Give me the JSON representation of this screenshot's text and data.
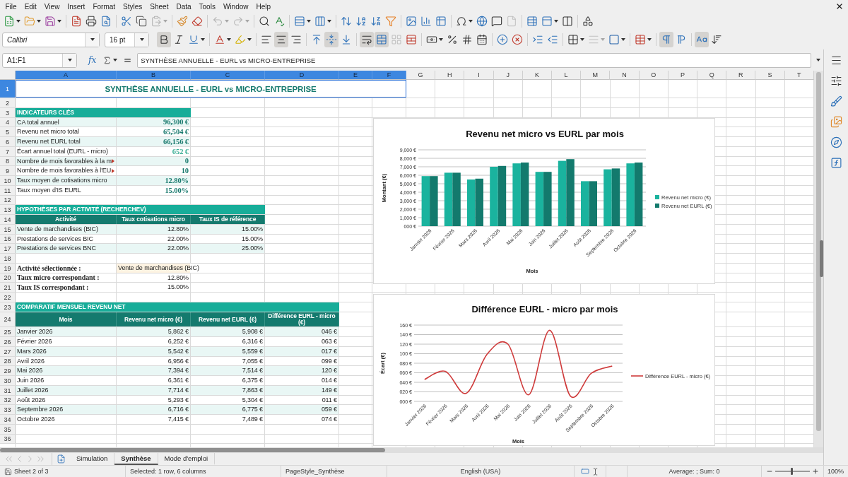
{
  "menu_bar": [
    "File",
    "Edit",
    "View",
    "Insert",
    "Format",
    "Styles",
    "Sheet",
    "Data",
    "Tools",
    "Window",
    "Help"
  ],
  "toolbar_standard": [
    [
      {
        "kind": "new",
        "active": false,
        "disabled": false,
        "menu": true
      },
      {
        "kind": "open",
        "active": false,
        "disabled": false,
        "menu": true
      },
      {
        "kind": "save",
        "active": false,
        "disabled": false,
        "menu": true
      }
    ],
    [
      {
        "kind": "export_pdf",
        "active": false,
        "disabled": false,
        "menu": false
      },
      {
        "kind": "print",
        "active": false,
        "disabled": false,
        "menu": false
      },
      {
        "kind": "print_preview",
        "active": false,
        "disabled": false,
        "menu": false
      }
    ],
    [
      {
        "kind": "cut",
        "active": false,
        "disabled": false,
        "menu": false
      },
      {
        "kind": "copy",
        "active": false,
        "disabled": false,
        "menu": false
      },
      {
        "kind": "paste",
        "active": false,
        "disabled": true,
        "menu": true
      }
    ],
    [
      {
        "kind": "clone_format",
        "active": false,
        "disabled": false,
        "menu": false
      },
      {
        "kind": "clear_format",
        "active": false,
        "disabled": false,
        "menu": false
      }
    ],
    [
      {
        "kind": "undo",
        "active": false,
        "disabled": true,
        "menu": true
      },
      {
        "kind": "redo",
        "active": false,
        "disabled": true,
        "menu": true
      }
    ],
    [
      {
        "kind": "find_replace",
        "active": false,
        "disabled": false,
        "menu": false
      },
      {
        "kind": "spelling",
        "active": false,
        "disabled": false,
        "menu": false
      }
    ],
    [
      {
        "kind": "rows",
        "active": false,
        "disabled": false,
        "menu": true
      },
      {
        "kind": "columns",
        "active": false,
        "disabled": false,
        "menu": true
      }
    ],
    [
      {
        "kind": "sort",
        "active": false,
        "disabled": false,
        "menu": false
      },
      {
        "kind": "sort_ascending",
        "active": false,
        "disabled": false,
        "menu": false
      },
      {
        "kind": "sort_descending",
        "active": false,
        "disabled": false,
        "menu": false
      },
      {
        "kind": "autofilter",
        "active": false,
        "disabled": false,
        "menu": false
      }
    ],
    [
      {
        "kind": "image",
        "active": false,
        "disabled": false,
        "menu": false
      },
      {
        "kind": "chart",
        "active": false,
        "disabled": false,
        "menu": false
      },
      {
        "kind": "pivot_table",
        "active": false,
        "disabled": false,
        "menu": false
      }
    ],
    [
      {
        "kind": "special_character",
        "active": false,
        "disabled": false,
        "menu": true
      },
      {
        "kind": "hyperlink",
        "active": false,
        "disabled": false,
        "menu": false
      },
      {
        "kind": "comment",
        "active": false,
        "disabled": false,
        "menu": false
      },
      {
        "kind": "header_footer",
        "active": false,
        "disabled": true,
        "menu": false
      }
    ],
    [
      {
        "kind": "print_area",
        "active": false,
        "disabled": false,
        "menu": false
      },
      {
        "kind": "freeze",
        "active": false,
        "disabled": false,
        "menu": true
      },
      {
        "kind": "split_window",
        "active": false,
        "disabled": false,
        "menu": false
      }
    ],
    [
      {
        "kind": "shapes",
        "active": false,
        "disabled": false,
        "menu": false
      }
    ]
  ],
  "toolbar_format": {
    "font_name": "Calibri",
    "font_size": "16 pt",
    "groups": [
      [
        {
          "kind": "bold",
          "active": true,
          "disabled": false,
          "menu": false
        },
        {
          "kind": "italic",
          "active": false,
          "disabled": false,
          "menu": false
        },
        {
          "kind": "underline",
          "active": false,
          "disabled": false,
          "menu": true
        }
      ],
      [
        {
          "kind": "font_color",
          "active": false,
          "disabled": false,
          "menu": true
        },
        {
          "kind": "highlight",
          "active": false,
          "disabled": false,
          "menu": true
        }
      ],
      [
        {
          "kind": "align_left",
          "active": false,
          "disabled": false,
          "menu": false
        },
        {
          "kind": "align_center",
          "active": true,
          "disabled": false,
          "menu": false
        },
        {
          "kind": "align_right",
          "active": false,
          "disabled": false,
          "menu": false
        }
      ],
      [
        {
          "kind": "align_top",
          "active": false,
          "disabled": false,
          "menu": false
        },
        {
          "kind": "align_middle",
          "active": true,
          "disabled": false,
          "menu": false
        },
        {
          "kind": "align_bottom",
          "active": false,
          "disabled": false,
          "menu": false
        }
      ],
      [
        {
          "kind": "wrap_text",
          "active": true,
          "disabled": false,
          "menu": false
        },
        {
          "kind": "merge_center",
          "active": true,
          "disabled": false,
          "menu": false
        },
        {
          "kind": "merge",
          "active": false,
          "disabled": true,
          "menu": false
        },
        {
          "kind": "unmerge",
          "active": false,
          "disabled": false,
          "menu": false
        }
      ],
      [
        {
          "kind": "currency",
          "active": false,
          "disabled": false,
          "menu": true
        },
        {
          "kind": "percent",
          "active": false,
          "disabled": false,
          "menu": false
        },
        {
          "kind": "number",
          "active": false,
          "disabled": false,
          "menu": false
        },
        {
          "kind": "date",
          "active": false,
          "disabled": false,
          "menu": false
        }
      ],
      [
        {
          "kind": "add_decimal",
          "active": false,
          "disabled": false,
          "menu": false
        },
        {
          "kind": "delete_decimal",
          "active": false,
          "disabled": false,
          "menu": false
        }
      ],
      [
        {
          "kind": "indent",
          "active": false,
          "disabled": false,
          "menu": false
        },
        {
          "kind": "outdent",
          "active": false,
          "disabled": false,
          "menu": false
        }
      ],
      [
        {
          "kind": "borders",
          "active": false,
          "disabled": false,
          "menu": true
        },
        {
          "kind": "border_style",
          "active": false,
          "disabled": true,
          "menu": true
        },
        {
          "kind": "border_color",
          "active": false,
          "disabled": false,
          "menu": true
        }
      ],
      [
        {
          "kind": "conditional",
          "active": false,
          "disabled": false,
          "menu": true
        }
      ],
      [
        {
          "kind": "ltr",
          "active": true,
          "disabled": false,
          "menu": false
        },
        {
          "kind": "rtl",
          "active": false,
          "disabled": false,
          "menu": false
        }
      ],
      [
        {
          "kind": "text_horizontal",
          "active": true,
          "disabled": false,
          "menu": false
        },
        {
          "kind": "text_vertical",
          "active": false,
          "disabled": false,
          "menu": false
        }
      ]
    ]
  },
  "formula_bar": {
    "name_box": "A1:F1",
    "function_wizard": "fx",
    "content": "SYNTHÈSE ANNUELLE - EURL vs MICRO-ENTREPRISE"
  },
  "sidebar": [
    {
      "kind": "menu"
    },
    {
      "kind": "properties"
    },
    {
      "kind": "styles"
    },
    {
      "kind": "gallery"
    },
    {
      "kind": "navigator"
    },
    {
      "kind": "functions"
    }
  ],
  "sheet": {
    "columns": [
      {
        "label": "A",
        "selected": true
      },
      {
        "label": "B",
        "selected": true
      },
      {
        "label": "C",
        "selected": true
      },
      {
        "label": "D",
        "selected": true
      },
      {
        "label": "E",
        "selected": true
      },
      {
        "label": "F",
        "selected": true
      },
      {
        "label": "G",
        "selected": false
      },
      {
        "label": "H",
        "selected": false
      },
      {
        "label": "I",
        "selected": false
      },
      {
        "label": "J",
        "selected": false
      },
      {
        "label": "K",
        "selected": false
      },
      {
        "label": "L",
        "selected": false
      },
      {
        "label": "M",
        "selected": false
      },
      {
        "label": "N",
        "selected": false
      },
      {
        "label": "O",
        "selected": false
      },
      {
        "label": "P",
        "selected": false
      },
      {
        "label": "Q",
        "selected": false
      },
      {
        "label": "R",
        "selected": false
      },
      {
        "label": "S",
        "selected": false
      },
      {
        "label": "T",
        "selected": false
      }
    ],
    "rows": [
      {
        "number": "1",
        "selected": true,
        "kind": "title",
        "text": "SYNTHÈSE ANNUELLE - EURL vs MICRO-ENTREPRISE"
      },
      {
        "number": "2",
        "selected": false,
        "kind": "blank"
      },
      {
        "number": "3",
        "selected": false,
        "kind": "section",
        "text": "INDICATEURS CLÉS"
      },
      {
        "number": "4",
        "selected": false,
        "kind": "indicator",
        "label": "CA total annuel",
        "value": "96,300 €",
        "color": "#1a7a6e",
        "clipped": false
      },
      {
        "number": "5",
        "selected": false,
        "kind": "indicator",
        "label": "Revenu net micro total",
        "value": "65,504 €",
        "color": "#1a7a6e",
        "clipped": false
      },
      {
        "number": "6",
        "selected": false,
        "kind": "indicator",
        "label": "Revenu net EURL total",
        "value": "66,156 €",
        "color": "#1a7a6e",
        "clipped": false
      },
      {
        "number": "7",
        "selected": false,
        "kind": "indicator",
        "label": "Écart annuel total (EURL - micro)",
        "value": "652 €",
        "color": "#3daf96",
        "clipped": false
      },
      {
        "number": "8",
        "selected": false,
        "kind": "indicator",
        "label": "Nombre de mois favorables à la m",
        "value": "0",
        "color": "#1a7a6e",
        "clipped": true
      },
      {
        "number": "9",
        "selected": false,
        "kind": "indicator",
        "label": "Nombre de mois favorables à l'EU",
        "value": "10",
        "color": "#1a7a6e",
        "clipped": true
      },
      {
        "number": "10",
        "selected": false,
        "kind": "indicator",
        "label": "Taux moyen de cotisations micro",
        "value": "12.80%",
        "color": "#1a7a6e",
        "clipped": false
      },
      {
        "number": "11",
        "selected": false,
        "kind": "indicator",
        "label": "Taux moyen d'IS EURL",
        "value": "15.00%",
        "color": "#1a7a6e",
        "clipped": false
      },
      {
        "number": "12",
        "selected": false,
        "kind": "blank"
      },
      {
        "number": "13",
        "selected": false,
        "kind": "section",
        "text": "HYPOTHÈSES PAR ACTIVITÉ (RECHERCHEV)"
      },
      {
        "number": "14",
        "selected": false,
        "kind": "header",
        "cells": [
          "Activité",
          "Taux cotisations micro",
          "Taux IS de référence"
        ]
      },
      {
        "number": "15",
        "selected": false,
        "kind": "data",
        "cells": [
          "Vente de marchandises (BIC)",
          "12.80%",
          "15.00%"
        ]
      },
      {
        "number": "16",
        "selected": false,
        "kind": "data",
        "cells": [
          "Prestations de services BIC",
          "22.00%",
          "15.00%"
        ]
      },
      {
        "number": "17",
        "selected": false,
        "kind": "data",
        "cells": [
          "Prestations de services BNC",
          "22.00%",
          "25.00%"
        ]
      },
      {
        "number": "18",
        "selected": false,
        "kind": "blank"
      },
      {
        "number": "19",
        "selected": false,
        "kind": "select_field",
        "label": "Activité sélectionnée :",
        "value": "Vente de marchandises (BIC)"
      },
      {
        "number": "20",
        "selected": false,
        "kind": "field",
        "label": "Taux micro correspondant :",
        "value": "12.80%"
      },
      {
        "number": "21",
        "selected": false,
        "kind": "field",
        "label": "Taux IS correspondant :",
        "value": "15.00%"
      },
      {
        "number": "22",
        "selected": false,
        "kind": "blank"
      },
      {
        "number": "23",
        "selected": false,
        "kind": "section",
        "text": "COMPARATIF MENSUEL REVENU NET"
      },
      {
        "number": "24",
        "selected": false,
        "kind": "header",
        "cells": [
          "Mois",
          "Revenu net micro (€)",
          "Revenu net EURL (€)",
          "Différence EURL - micro (€)"
        ]
      },
      {
        "number": "25",
        "selected": false,
        "kind": "data",
        "cells": [
          "Janvier 2026",
          "5,862 €",
          "5,908 €",
          "046 €"
        ]
      },
      {
        "number": "26",
        "selected": false,
        "kind": "data",
        "cells": [
          "Février 2026",
          "6,252 €",
          "6,316 €",
          "063 €"
        ]
      },
      {
        "number": "27",
        "selected": false,
        "kind": "data",
        "cells": [
          "Mars 2026",
          "5,542 €",
          "5,559 €",
          "017 €"
        ]
      },
      {
        "number": "28",
        "selected": false,
        "kind": "data",
        "cells": [
          "Avril 2026",
          "6,956 €",
          "7,055 €",
          "099 €"
        ]
      },
      {
        "number": "29",
        "selected": false,
        "kind": "data",
        "cells": [
          "Mai 2026",
          "7,394 €",
          "7,514 €",
          "120 €"
        ]
      },
      {
        "number": "30",
        "selected": false,
        "kind": "data",
        "cells": [
          "Juin 2026",
          "6,361 €",
          "6,375 €",
          "014 €"
        ]
      },
      {
        "number": "31",
        "selected": false,
        "kind": "data",
        "cells": [
          "Juillet 2026",
          "7,714 €",
          "7,863 €",
          "149 €"
        ]
      },
      {
        "number": "32",
        "selected": false,
        "kind": "data",
        "cells": [
          "Août 2026",
          "5,293 €",
          "5,304 €",
          "011 €"
        ]
      },
      {
        "number": "33",
        "selected": false,
        "kind": "data",
        "cells": [
          "Septembre 2026",
          "6,716 €",
          "6,775 €",
          "059 €"
        ]
      },
      {
        "number": "34",
        "selected": false,
        "kind": "data",
        "cells": [
          "Octobre 2026",
          "7,415 €",
          "7,489 €",
          "074 €"
        ]
      },
      {
        "number": "35",
        "selected": false,
        "kind": "blank"
      },
      {
        "number": "36",
        "selected": false,
        "kind": "blank"
      }
    ]
  },
  "charts": [
    {
      "chart_data": {
        "type": "bar",
        "title": "Revenu net micro vs EURL par mois",
        "xlabel": "Mois",
        "ylabel": "Montant (€)",
        "categories": [
          "Janvier 2026",
          "Février 2026",
          "Mars 2026",
          "Avril 2026",
          "Mai 2026",
          "Juin 2026",
          "Juillet 2026",
          "Août 2026",
          "Septembre 2026",
          "Octobre 2026"
        ],
        "series": [
          {
            "name": "Revenu net micro (€)",
            "color": "#1ab39e",
            "values": [
              5900,
              6300,
              5500,
              7000,
              7400,
              6400,
              7700,
              5300,
              6700,
              7400
            ]
          },
          {
            "name": "Revenu net EURL (€)",
            "color": "#137a6d",
            "values": [
              5900,
              6300,
              5600,
              7100,
              7500,
              6400,
              7900,
              5300,
              6800,
              7500
            ]
          }
        ],
        "ylim": [
          0,
          9000
        ],
        "yticks": [
          {
            "value": 0,
            "label": "000 €"
          },
          {
            "value": 1000,
            "label": "1,000 €"
          },
          {
            "value": 2000,
            "label": "2,000 €"
          },
          {
            "value": 3000,
            "label": "3,000 €"
          },
          {
            "value": 4000,
            "label": "4,000 €"
          },
          {
            "value": 5000,
            "label": "5,000 €"
          },
          {
            "value": 6000,
            "label": "6,000 €"
          },
          {
            "value": 7000,
            "label": "7,000 €"
          },
          {
            "value": 8000,
            "label": "8,000 €"
          },
          {
            "value": 9000,
            "label": "9,000 €"
          }
        ],
        "grid": true,
        "legend": "right"
      }
    },
    {
      "chart_data": {
        "type": "line",
        "title": "Différence EURL - micro par mois",
        "xlabel": "Mois",
        "ylabel": "Écart (€)",
        "categories": [
          "Janvier 2026",
          "Février 2026",
          "Mars 2026",
          "Avril 2026",
          "Mai 2026",
          "Juin 2026",
          "Juillet 2026",
          "Août 2026",
          "Septembre 2026",
          "Octobre 2026"
        ],
        "series": [
          {
            "name": "Différence EURL - micro (€)",
            "color": "#cf3b3b",
            "values": [
              46,
              63,
              17,
              99,
              120,
              14,
              149,
              11,
              59,
              74
            ]
          }
        ],
        "ylim": [
          0,
          160
        ],
        "yticks": [
          {
            "value": 0,
            "label": "000 €"
          },
          {
            "value": 20,
            "label": "020 €"
          },
          {
            "value": 40,
            "label": "040 €"
          },
          {
            "value": 60,
            "label": "060 €"
          },
          {
            "value": 80,
            "label": "080 €"
          },
          {
            "value": 100,
            "label": "100 €"
          },
          {
            "value": 120,
            "label": "120 €"
          },
          {
            "value": 140,
            "label": "140 €"
          },
          {
            "value": 160,
            "label": "160 €"
          }
        ],
        "grid": true,
        "legend": "right"
      }
    }
  ],
  "sheet_navigation": [
    {
      "kind": "first",
      "disabled": true
    },
    {
      "kind": "previous",
      "disabled": true
    },
    {
      "kind": "next",
      "disabled": true
    },
    {
      "kind": "last",
      "disabled": true
    }
  ],
  "sheet_tabs": [
    {
      "label": "Simulation",
      "selected": false
    },
    {
      "label": "Synthèse",
      "selected": true
    },
    {
      "label": "Mode d'emploi",
      "selected": false
    }
  ],
  "status_bar": {
    "sheet": "Sheet 2 of 3",
    "selection": "Selected: 1 row, 6 columns",
    "page_style": "PageStyle_Synthèse",
    "language": "English (USA)",
    "summary": "Average: ; Sum: 0",
    "zoom": {
      "level": 0.47,
      "reading": "100%"
    }
  }
}
